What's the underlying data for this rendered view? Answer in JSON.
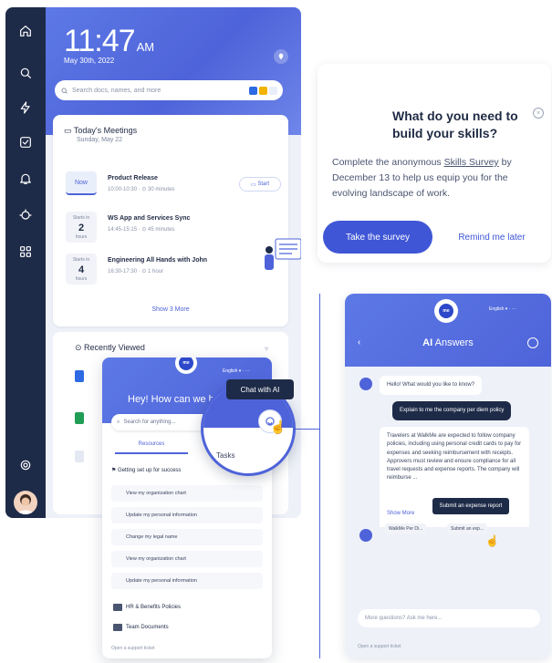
{
  "sidebar": {
    "icons": [
      "home-icon",
      "search-icon",
      "lightning-icon",
      "checkbox-icon",
      "bell-icon",
      "bot-icon",
      "apps-icon"
    ],
    "settings_icon": "gear-icon"
  },
  "home": {
    "time": "11:47",
    "ampm": "AM",
    "date": "May 30th, 2022",
    "search_placeholder": "Search docs, names, and more",
    "meetings": {
      "title": "Today's Meetings",
      "subtitle": "Sunday, May 22",
      "items": [
        {
          "badge": "Now",
          "name": "Product Release",
          "meta": "10:00-10:30 · ⊙ 30 minutes",
          "action": "Start"
        },
        {
          "starts_in": "Starts in",
          "num": "2",
          "unit": "hours",
          "name": "WS App and Services Sync",
          "meta": "14:45-15:15 · ⊙ 45 minutes"
        },
        {
          "starts_in": "Starts in",
          "num": "4",
          "unit": "hours",
          "name": "Engineering All Hands with John",
          "meta": "16:30-17:30 · ⊙ 1 hour"
        }
      ],
      "show_more": "Show 3 More"
    },
    "recent_title": "Recently Viewed"
  },
  "chat_popup": {
    "lang": "English",
    "greeting": "Hey! How can we h",
    "search_placeholder": "Search for anything...",
    "tab_resources": "Resources",
    "tab_tasks": "Tasks",
    "section": "Getting set up for success",
    "items": [
      "View my organization chart",
      "Update my personal information",
      "Change my legal name",
      "View my organization chart",
      "Update my personal information"
    ],
    "folders": [
      "HR & Benefits Policies",
      "Team Documents"
    ],
    "footer": "Open a support ticket",
    "tooltip": "Chat with AI",
    "logo_text": "me"
  },
  "survey": {
    "question": "What do you need to build your skills?",
    "body_pre": "Complete the anonymous ",
    "body_link": "Skills Survey",
    "body_post": " by December 13 to help us equip you for the evolving landscape of work.",
    "cta": "Take the survey",
    "secondary": "Remind me later",
    "close": "×"
  },
  "ai": {
    "lang": "English",
    "title_prefix": "AI",
    "title_suffix": " Answers",
    "logo_text": "me",
    "greeting": "Hello! What would you like to know?",
    "user_msg": "Explain to me the company per diem policy",
    "answer": "Travelers at WalkMe are expected to follow company policies, including using personal credit cards to pay for expenses and seeking reimbursement with receipts. Approvers must review and ensure compliance for all travel requests and expense reports. The company will reimburse ...",
    "show_more": "Show More",
    "sources": [
      "WalkMe Per Di...",
      "Submit an exp..."
    ],
    "tooltip": "Submit an expense report",
    "input_placeholder": "More questions? Ask me here...",
    "footer": "Open a support ticket"
  },
  "colors": {
    "navy": "#1e2b48",
    "accent": "#4e63d9",
    "button": "#3f56d6"
  }
}
